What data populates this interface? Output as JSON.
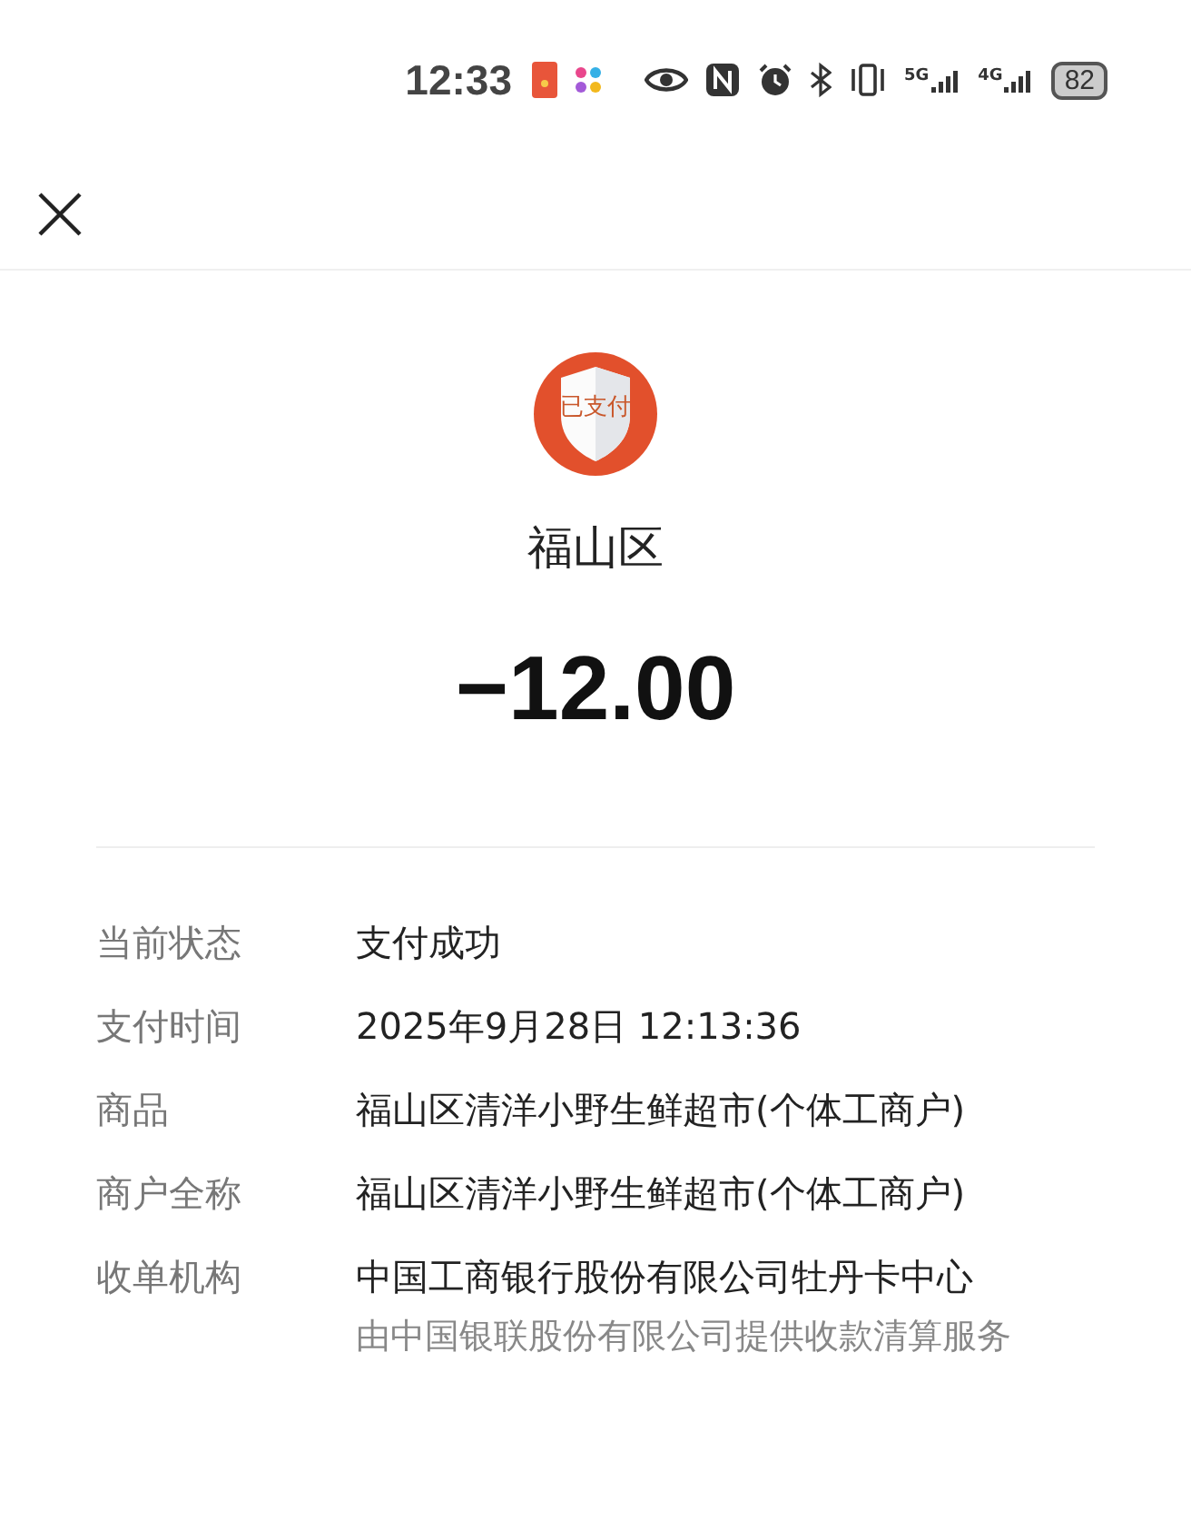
{
  "status_bar": {
    "time": "12:33",
    "network_1": "5G",
    "network_2": "4G",
    "battery": "82"
  },
  "badge": {
    "text": "已支付"
  },
  "merchant": "福山区",
  "amount": "−12.00",
  "details": [
    {
      "label": "当前状态",
      "value": "支付成功"
    },
    {
      "label": "支付时间",
      "value": "2025年9月28日 12:13:36"
    },
    {
      "label": "商品",
      "value": "福山区清洋小野生鲜超市(个体工商户)"
    },
    {
      "label": "商户全称",
      "value": "福山区清洋小野生鲜超市(个体工商户)"
    },
    {
      "label": "收单机构",
      "value": "中国工商银行股份有限公司牡丹卡中心",
      "note": "由中国银联股份有限公司提供收款清算服务"
    }
  ]
}
